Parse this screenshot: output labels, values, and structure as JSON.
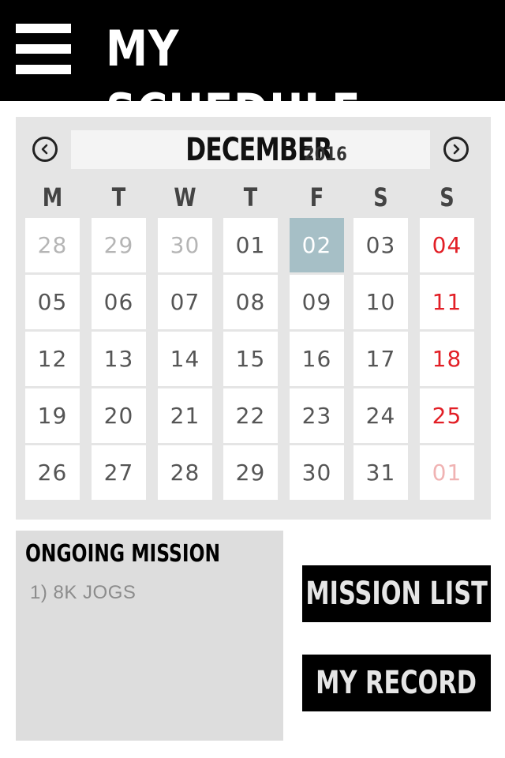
{
  "header": {
    "title": "MY SCHEDULE",
    "menu_icon": "hamburger-menu-icon"
  },
  "calendar": {
    "month": "DECEMBER",
    "year": "2016",
    "prev_icon": "chevron-left-circle-icon",
    "next_icon": "chevron-right-circle-icon",
    "weekdays": [
      "M",
      "T",
      "W",
      "T",
      "F",
      "S",
      "S"
    ],
    "weeks": [
      [
        "28",
        "29",
        "30",
        "01",
        "02",
        "03",
        "04"
      ],
      [
        "05",
        "06",
        "07",
        "08",
        "09",
        "10",
        "11"
      ],
      [
        "12",
        "13",
        "14",
        "15",
        "16",
        "17",
        "18"
      ],
      [
        "19",
        "20",
        "21",
        "22",
        "23",
        "24",
        "25"
      ],
      [
        "26",
        "27",
        "28",
        "29",
        "30",
        "31",
        "01"
      ]
    ],
    "selected_day": "02",
    "colors": {
      "selected_bg": "#a6bfc6",
      "sunday": "#e21f26",
      "muted": "#b5b5b5"
    }
  },
  "mission": {
    "title": "ONGOING MISSION",
    "items": [
      "1) 8K JOGS"
    ]
  },
  "buttons": {
    "mission_list": "MISSION LIST",
    "my_record": "MY RECORD"
  }
}
